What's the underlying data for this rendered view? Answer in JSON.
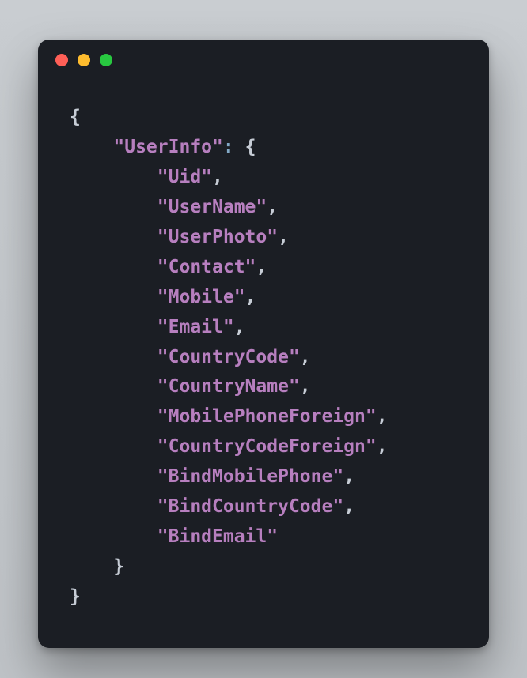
{
  "window": {
    "traffic_lights": [
      "close",
      "minimize",
      "zoom"
    ]
  },
  "code": {
    "root_key": "UserInfo",
    "fields": [
      "Uid",
      "UserName",
      "UserPhoto",
      "Contact",
      "Mobile",
      "Email",
      "CountryCode",
      "CountryName",
      "MobilePhoneForeign",
      "CountryCodeForeign",
      "BindMobilePhone",
      "BindCountryCode",
      "BindEmail"
    ],
    "braces": {
      "open": "{",
      "close": "}"
    },
    "colon": ":",
    "comma": ","
  }
}
